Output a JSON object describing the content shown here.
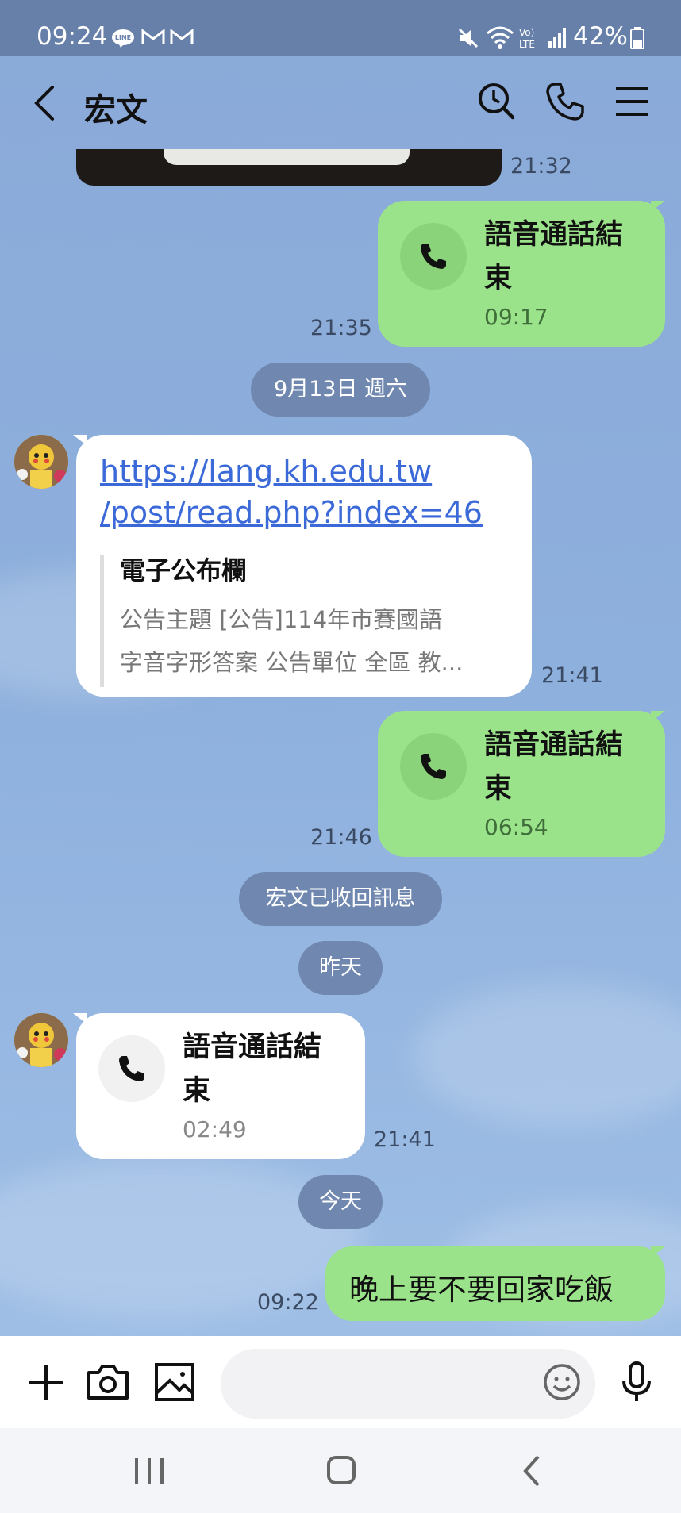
{
  "status_bar": {
    "time": "09:24",
    "battery_percent": "42%",
    "left_icons": [
      "line-app-icon",
      "gmail-icon",
      "gmail-icon"
    ],
    "right_icons": [
      "mute-icon",
      "wifi-icon",
      "volte-icon",
      "signal-icon",
      "battery-icon"
    ]
  },
  "header": {
    "title": "宏文",
    "actions": [
      "search-icon",
      "phone-icon",
      "menu-icon"
    ]
  },
  "messages": {
    "image_time": "21:32",
    "call1": {
      "title": "語音通話結束",
      "title_line1": "語音通話結",
      "title_line2": "束",
      "duration": "09:17",
      "time": "21:35"
    },
    "date1": "9月13日 週六",
    "link_msg": {
      "url_line1": "https://lang.kh.edu.tw",
      "url_line2": "/post/read.php?index=46",
      "preview_title": "電子公布欄",
      "preview_line1": "公告主題 [公告]114年市賽國語",
      "preview_line2": "字音字形答案 公告單位 全區 教...",
      "time": "21:41"
    },
    "call2": {
      "title_line1": "語音通話結",
      "title_line2": "束",
      "duration": "06:54",
      "time": "21:46"
    },
    "recall_notice": "宏文已收回訊息",
    "date2": "昨天",
    "call3": {
      "title_line1": "語音通話結",
      "title_line2": "束",
      "duration": "02:49",
      "time": "21:41"
    },
    "date3": "今天",
    "text_msg": {
      "text": "晚上要不要回家吃飯",
      "time": "09:22"
    }
  },
  "input_bar": {
    "placeholder": "",
    "buttons": [
      "plus-icon",
      "camera-icon",
      "image-icon",
      "emoji-icon",
      "microphone-icon"
    ]
  },
  "nav_bar": {
    "buttons": [
      "recent-apps-icon",
      "home-icon",
      "back-icon"
    ]
  },
  "colors": {
    "bubble_green": "#9be38a",
    "link_blue": "#3b6ad8",
    "pill_bg": "#7088b0"
  }
}
